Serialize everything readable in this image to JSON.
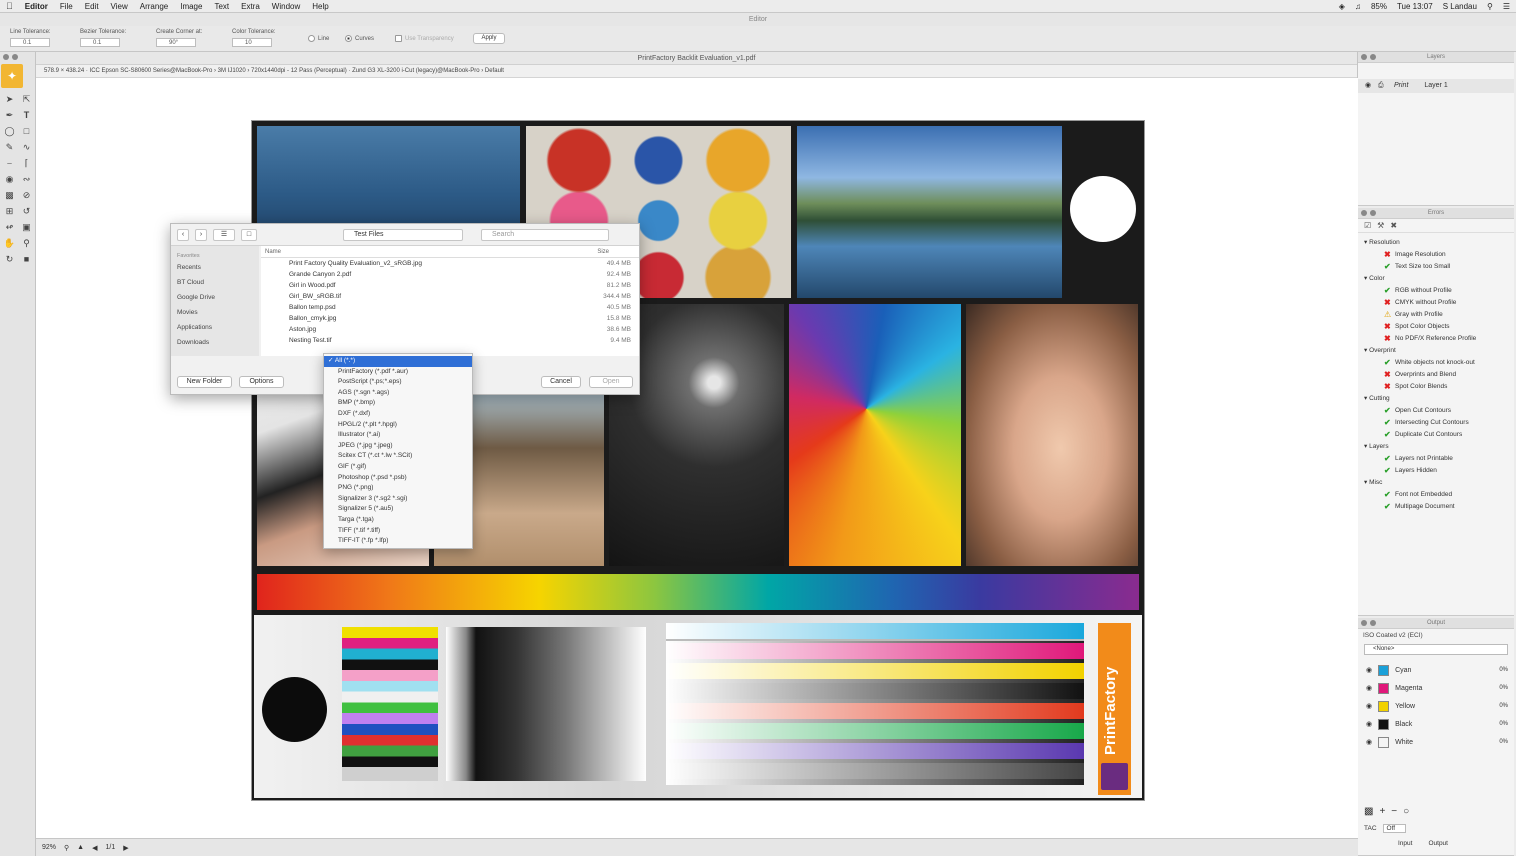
{
  "menubar": {
    "apple": "",
    "items": [
      "Editor",
      "File",
      "Edit",
      "View",
      "Arrange",
      "Image",
      "Text",
      "Extra",
      "Window",
      "Help"
    ],
    "battery": "85%",
    "clock": "Tue 13:07",
    "user": "S Landau"
  },
  "editor_title": "Editor",
  "options": {
    "line_tolerance_label": "Line Tolerance:",
    "line_tolerance_value": "0.1",
    "bezier_tolerance_label": "Bezier Tolerance:",
    "bezier_tolerance_value": "0.1",
    "create_corner_label": "Create Corner at:",
    "create_corner_value": "90°",
    "color_tolerance_label": "Color Tolerance:",
    "color_tolerance_value": "10",
    "radio_line": "Line",
    "radio_curves": "Curves",
    "use_transparency": "Use Transparency",
    "apply": "Apply"
  },
  "document": {
    "title": "PrintFactory Backlit Evaluation_v1.pdf",
    "info": "578.9 × 438.24  ·  ICC  Epson SC-S80600 Series@MacBook-Pro › 3M IJ1020 › 720x1440dpi - 12 Pass (Perceptual)  ·  Zund G3 XL-3200 i-Cut (legacy)@MacBook-Pro › Default",
    "brand": "PrintFactory"
  },
  "dialog": {
    "folder": "Test Files",
    "search_placeholder": "Search",
    "favorites_header": "Favorites",
    "favorites": [
      "Recents",
      "BT Cloud",
      "Google Drive",
      "Movies",
      "Applications",
      "Downloads"
    ],
    "col_name": "Name",
    "col_size": "Size",
    "files": [
      {
        "name": "Print Factory Quality Evaluation_v2_sRGB.jpg",
        "size": "49.4 MB"
      },
      {
        "name": "Grande Canyon 2.pdf",
        "size": "92.4 MB"
      },
      {
        "name": "Girl in Wood.pdf",
        "size": "81.2 MB"
      },
      {
        "name": "Girl_BW_sRGB.tif",
        "size": "344.4 MB"
      },
      {
        "name": "Ballon temp.psd",
        "size": "40.5 MB"
      },
      {
        "name": "Ballon_cmyk.jpg",
        "size": "15.8 MB"
      },
      {
        "name": "Aston.jpg",
        "size": "38.6 MB"
      },
      {
        "name": "Nesting Test.tif",
        "size": "9.4 MB"
      }
    ],
    "new_folder": "New Folder",
    "options": "Options",
    "cancel": "Cancel",
    "open": "Open"
  },
  "format_menu": {
    "selected": "✓ All (*.*)",
    "items": [
      "PrintFactory (*.pdf *.aur)",
      "PostScript (*.ps;*.eps)",
      "AGS (*.sgn *.ags)",
      "BMP (*.bmp)",
      "DXF (*.dxf)",
      "HPGL/2 (*.plt *.hpgl)",
      "Illustrator (*.ai)",
      "JPEG (*.jpg *.jpeg)",
      "Scitex CT (*.ct *.lw *.SCit)",
      "GIF (*.gif)",
      "Photoshop (*.psd *.psb)",
      "PNG (*.png)",
      "Signalizer 3 (*.sg2 *.sgi)",
      "Signalizer 5 (*.au5)",
      "Targa (*.tga)",
      "TIFF (*.tif *.tiff)",
      "TIFF-IT (*.fp *.lfp)"
    ]
  },
  "layers_panel": {
    "title": "Layers",
    "row_type": "Print",
    "row_name": "Layer 1"
  },
  "errors_panel": {
    "title": "Errors",
    "groups": [
      {
        "name": "Resolution",
        "items": [
          {
            "label": "Image Resolution",
            "status": "error"
          },
          {
            "label": "Text Size too Small",
            "status": "ok"
          }
        ]
      },
      {
        "name": "Color",
        "items": [
          {
            "label": "RGB without Profile",
            "status": "ok"
          },
          {
            "label": "CMYK without Profile",
            "status": "error"
          },
          {
            "label": "Gray with Profile",
            "status": "warn"
          },
          {
            "label": "Spot Color Objects",
            "status": "error"
          },
          {
            "label": "No PDF/X Reference Profile",
            "status": "error"
          }
        ]
      },
      {
        "name": "Overprint",
        "items": [
          {
            "label": "White objects not knock-out",
            "status": "ok"
          },
          {
            "label": "Overprints and Blend",
            "status": "error"
          },
          {
            "label": "Spot Color Blends",
            "status": "error"
          }
        ]
      },
      {
        "name": "Cutting",
        "items": [
          {
            "label": "Open Cut Contours",
            "status": "ok"
          },
          {
            "label": "Intersecting Cut Contours",
            "status": "ok"
          },
          {
            "label": "Duplicate Cut Contours",
            "status": "ok"
          }
        ]
      },
      {
        "name": "Layers",
        "items": [
          {
            "label": "Layers not Printable",
            "status": "ok"
          },
          {
            "label": "Layers Hidden",
            "status": "ok"
          }
        ]
      },
      {
        "name": "Misc",
        "items": [
          {
            "label": "Font not Embedded",
            "status": "ok"
          },
          {
            "label": "Multipage Document",
            "status": "ok"
          }
        ]
      }
    ]
  },
  "output_panel": {
    "title": "Output",
    "profile": "ISO Coated v2 (ECI)",
    "select": "<None>",
    "inks": [
      {
        "name": "Cyan",
        "pct": "0%",
        "color": "#1aa0d8"
      },
      {
        "name": "Magenta",
        "pct": "0%",
        "color": "#e0187a"
      },
      {
        "name": "Yellow",
        "pct": "0%",
        "color": "#f2d200"
      },
      {
        "name": "Black",
        "pct": "0%",
        "color": "#111111"
      },
      {
        "name": "White",
        "pct": "0%",
        "color": "#f4f4f4"
      }
    ],
    "tac_label": "TAC",
    "tac_value": "Off",
    "tab_input": "Input",
    "tab_output": "Output"
  },
  "status": {
    "zoom": "92%",
    "page": "1/1"
  }
}
